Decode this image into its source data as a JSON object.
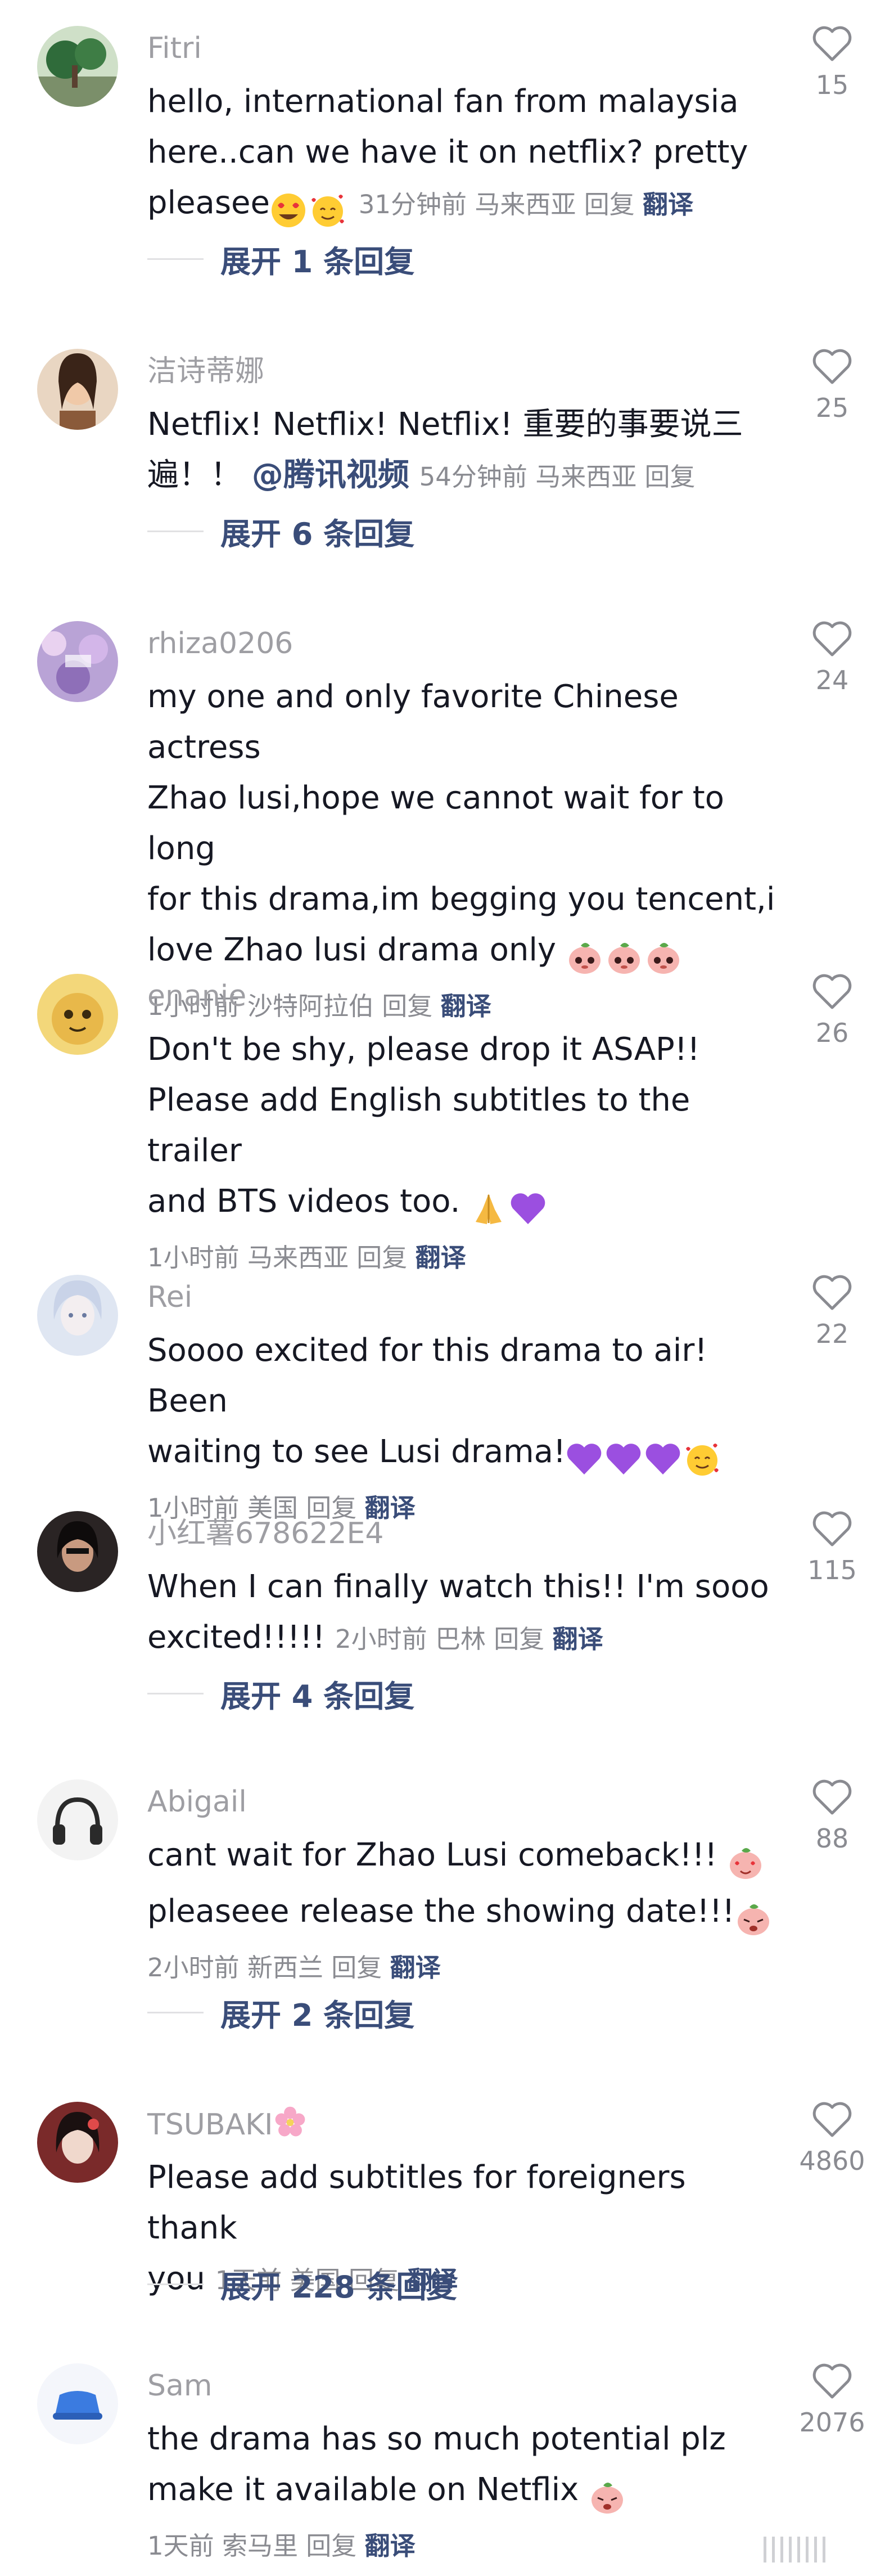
{
  "comments": [
    {
      "user": "Fitri",
      "lines": [
        "hello, international fan from malaysia",
        "here..can we have it on netflix? pretty",
        "pleasee"
      ],
      "time": "31分钟前",
      "location": "马来西亚",
      "reply": "回复",
      "translate": "翻译",
      "likes": "15",
      "expand": "展开 1 条回复"
    },
    {
      "user": "洁诗蒂娜",
      "lines": [
        "Netflix! Netflix! Netflix! 重要的事要说三",
        "遍！！"
      ],
      "mention": "@腾讯视频",
      "time": "54分钟前",
      "location": "马来西亚",
      "reply": "回复",
      "likes": "25",
      "expand": "展开 6 条回复"
    },
    {
      "user": "rhiza0206",
      "lines": [
        "my one and only favorite Chinese actress",
        "Zhao lusi,hope we cannot wait for to long",
        "for this drama,im begging you tencent,i",
        "love Zhao lusi drama only"
      ],
      "time": "1小时前",
      "location": "沙特阿拉伯",
      "reply": "回复",
      "translate": "翻译",
      "likes": "24"
    },
    {
      "user": "enanie",
      "lines": [
        "Don't be shy, please drop it ASAP!!",
        "Please add English subtitles to the trailer",
        "and BTS videos too."
      ],
      "time": "1小时前",
      "location": "马来西亚",
      "reply": "回复",
      "translate": "翻译",
      "likes": "26"
    },
    {
      "user": "Rei",
      "lines": [
        "Soooo excited for this drama to air! Been",
        "waiting to see Lusi drama!"
      ],
      "time": "1小时前",
      "location": "美国",
      "reply": "回复",
      "translate": "翻译",
      "likes": "22"
    },
    {
      "user": "小红薯678622E4",
      "lines": [
        "When I can finally watch this!! I'm sooo",
        "excited!!!!!"
      ],
      "time": "2小时前",
      "location": "巴林",
      "reply": "回复",
      "translate": "翻译",
      "likes": "115",
      "expand": "展开 4 条回复"
    },
    {
      "user": "Abigail",
      "lines": [
        "cant wait for Zhao Lusi comeback!!!",
        "pleaseee release the showing date!!!"
      ],
      "time": "2小时前",
      "location": "新西兰",
      "reply": "回复",
      "translate": "翻译",
      "likes": "88",
      "expand": "展开 2 条回复"
    },
    {
      "user": "TSUBAKI",
      "lines": [
        "Please add subtitles for foreigners thank",
        "you"
      ],
      "time": "1天前",
      "location": "美国",
      "reply": "回复",
      "translate": "翻译",
      "likes": "4860",
      "expand": "展开 228 条回复"
    },
    {
      "user": "Sam",
      "lines": [
        "the drama has so much potential plz",
        "make it available on Netflix"
      ],
      "time": "1天前",
      "location": "索马里",
      "reply": "回复",
      "translate": "翻译",
      "likes": "2076"
    }
  ],
  "icons": {
    "like": "heart-outline-icon",
    "emoji": [
      "heart-eyes-emoji",
      "smiling-hearts-emoji",
      "peach-pleading-emoji",
      "folded-hands-emoji",
      "purple-heart-emoji",
      "peach-heart-eyes-emoji",
      "peach-crying-emoji",
      "cherry-blossom-emoji"
    ]
  },
  "colors": {
    "text": "#161823",
    "username": "#9e9ea3",
    "meta": "#8a8b91",
    "link": "#3a4d79",
    "divider": "#e1e1e3"
  }
}
